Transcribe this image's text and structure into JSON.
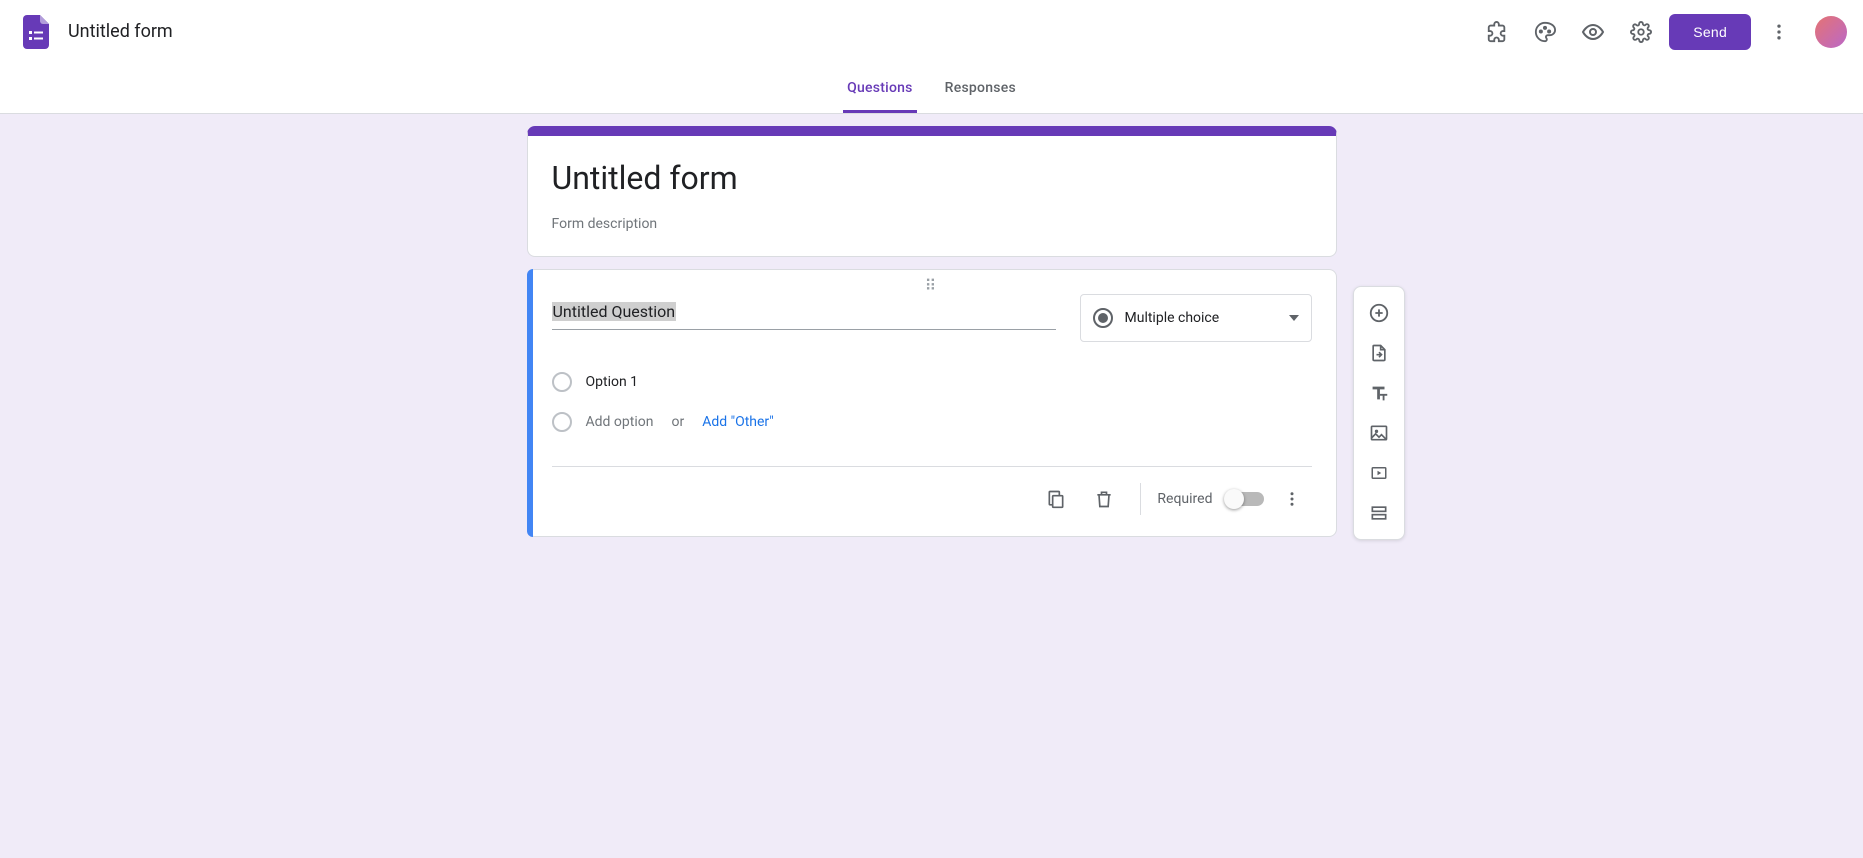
{
  "header": {
    "title": "Untitled form",
    "send_label": "Send"
  },
  "tabs": {
    "questions": "Questions",
    "responses": "Responses"
  },
  "form": {
    "title": "Untitled form",
    "description_placeholder": "Form description"
  },
  "question": {
    "title": "Untitled Question",
    "type_label": "Multiple choice",
    "options": [
      {
        "label": "Option 1"
      }
    ],
    "add_option_placeholder": "Add option",
    "or_label": "or",
    "add_other_label": "Add \"Other\"",
    "required_label": "Required"
  },
  "icons": {
    "addons": "addons-icon",
    "palette": "palette-icon",
    "preview": "eye-icon",
    "settings": "gear-icon",
    "more": "more-vert-icon",
    "copy": "copy-icon",
    "delete": "trash-icon",
    "add_question": "plus-circle-icon",
    "import_questions": "import-icon",
    "add_title": "title-icon",
    "add_image": "image-icon",
    "add_video": "video-icon",
    "add_section": "section-icon"
  }
}
